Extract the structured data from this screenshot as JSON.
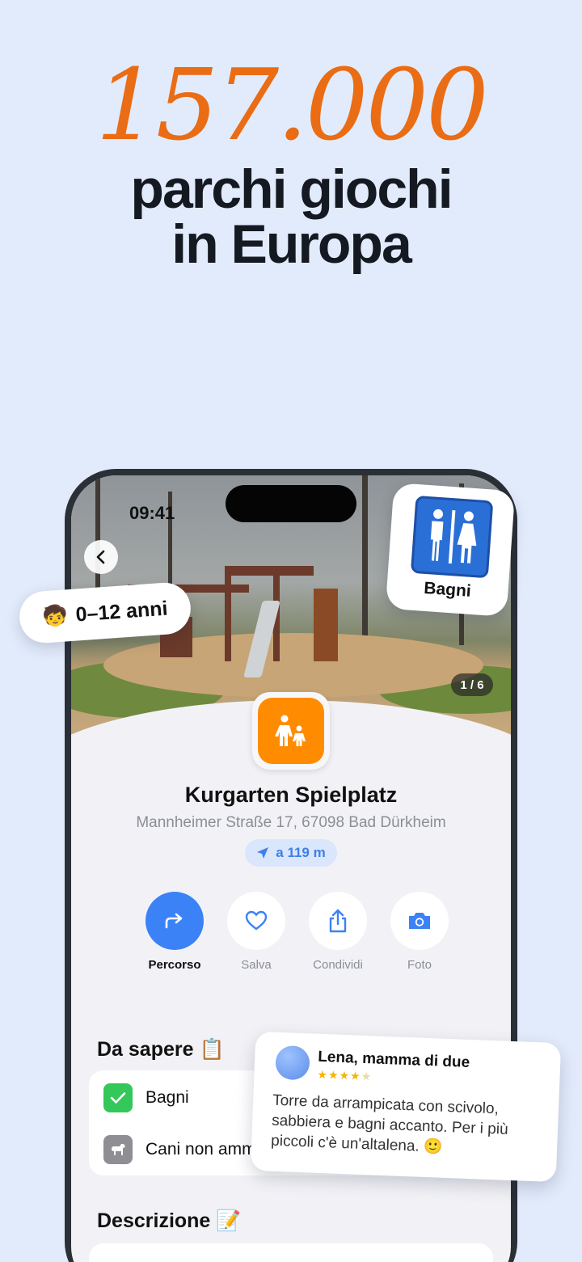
{
  "hero": {
    "number": "157.000",
    "line1": "parchi giochi",
    "line2": "in Europa"
  },
  "status_bar": {
    "time": "09:41"
  },
  "gallery": {
    "counter": "1 / 6"
  },
  "place": {
    "title": "Kurgarten Spielplatz",
    "address": "Mannheimer Straße 17, 67098 Bad Dürkheim",
    "distance": "a 119 m"
  },
  "actions": [
    {
      "label": "Percorso",
      "icon": "route-arrow-icon"
    },
    {
      "label": "Salva",
      "icon": "heart-icon"
    },
    {
      "label": "Condividi",
      "icon": "share-icon"
    },
    {
      "label": "Foto",
      "icon": "camera-icon"
    }
  ],
  "know": {
    "title": "Da sapere 📋",
    "items": [
      {
        "label": "Bagni",
        "icon": "check-icon",
        "color": "#34c759"
      },
      {
        "label": "Cani non amm",
        "icon": "dog-icon",
        "color": "#8e8e93"
      }
    ]
  },
  "description": {
    "title": "Descrizione 📝"
  },
  "age_chip": {
    "emoji": "🧒",
    "label": "0–12 anni"
  },
  "bath_card": {
    "label": "Bagni"
  },
  "review": {
    "name": "Lena, mamma di due",
    "rating": 4,
    "text": "Torre da arrampicata con scivolo, sabbiera e bagni accanto. Per i più piccoli c'è un'altalena. 🙂"
  },
  "colors": {
    "background": "#e2ebfb",
    "accent_orange": "#ea6c14",
    "primary_blue": "#3b82f6",
    "success_green": "#34c759"
  }
}
